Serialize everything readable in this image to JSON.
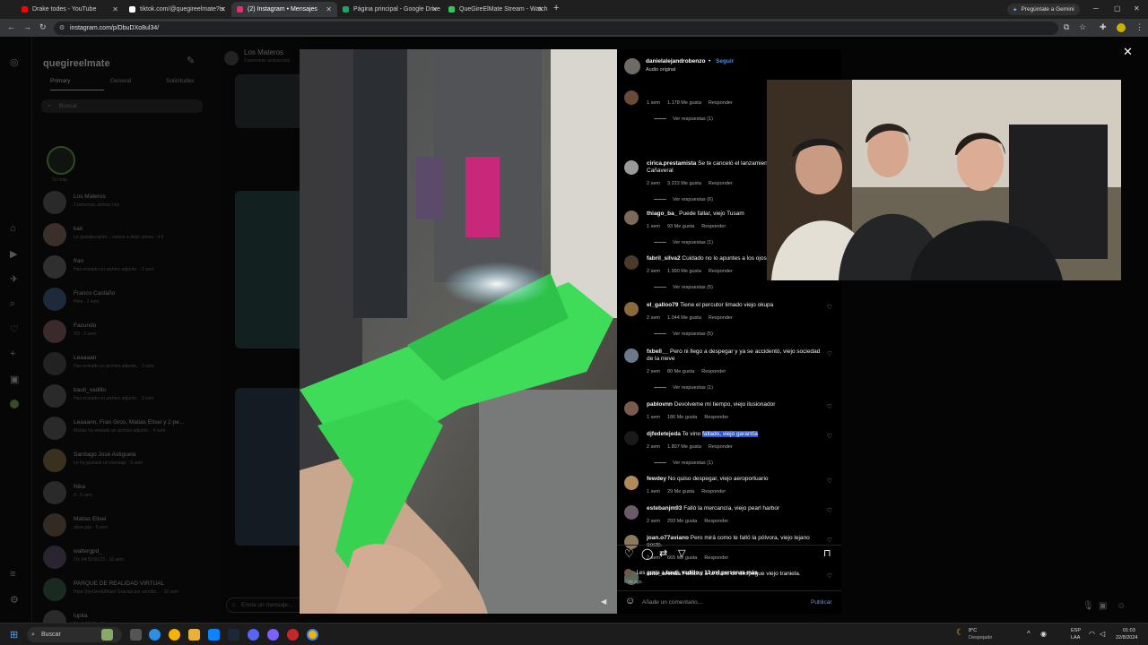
{
  "browser": {
    "tabs": [
      {
        "label": "Drake todes - YouTube",
        "active": false,
        "color": "#ff0000"
      },
      {
        "label": "tiktok.com/@quegireelmate?is",
        "active": false,
        "color": "#ffffff"
      },
      {
        "label": "(2) Instagram • Mensajes",
        "active": true,
        "color": "#e1306c"
      },
      {
        "label": "Página principal - Google Drive",
        "active": false,
        "color": "#1fa463"
      },
      {
        "label": "QueGireElMate Stream - Watch",
        "active": false,
        "color": "#34c759"
      }
    ],
    "gemini_label": "Pregúntale a Gemini",
    "url": "instagram.com/p/DbuDXo8ul34/"
  },
  "sidebar_icons": [
    "instagram-icon",
    "home-icon",
    "reels-icon",
    "messages-icon",
    "search-icon",
    "notifications-icon",
    "create-icon",
    "profile-icon",
    "menu-icon",
    "more-icon"
  ],
  "dm": {
    "username": "quegireelmate",
    "tabs": [
      "Primary",
      "General",
      "Solicitudes"
    ],
    "search_placeholder": "Buscar",
    "note_caption": "Tu nota",
    "conversations": [
      {
        "name": "Los Materos",
        "sub": "2 personas activas hoy"
      },
      {
        "name": "kari",
        "sub": "Le gustaba tanto... vamos a dejar juntas · 4 d"
      },
      {
        "name": "fran",
        "sub": "Has enviado un archivo adjunto. · 2 sem"
      },
      {
        "name": "Franco Castaño",
        "sub": "Hola · 2 sem"
      },
      {
        "name": "Facundo",
        "sub": "XD · 2 sem"
      },
      {
        "name": "Leaaaan",
        "sub": "Has enviado un archivo adjunto. · 3 sem"
      },
      {
        "name": "bauti_vadillo",
        "sub": "Has enviado un archivo adjunto. · 3 sem"
      },
      {
        "name": "Leaaann, Fran Gros, Matias Elisei y 2 pe...",
        "sub": "Matias ha enviado un archivo adjunto. · 4 sem"
      },
      {
        "name": "Santiago José Astiguela",
        "sub": "Le ha gustado un mensaje · 5 sem"
      },
      {
        "name": "Nika",
        "sub": "3 · 5 sem"
      },
      {
        "name": "Matias Elisei",
        "sub": "abue juju · 5 sem"
      },
      {
        "name": "waltergpd_",
        "sub": "Tú: 04:53:00:23 · 10 sem"
      },
      {
        "name": "PARQUE DE REALIDAD VIRTUAL",
        "sub": "Hola QueGireElMate! Gracias por escribir... · 10 sem"
      },
      {
        "name": "lupita",
        "sub": "Tú: 0:00:00 · 10 sem"
      }
    ]
  },
  "chat": {
    "title": "Los Materos",
    "subtitle": "2 personas activas hoy",
    "input_placeholder": "Envía un mensaje..."
  },
  "post": {
    "author": "danielalejandrobenzo",
    "follow": "Seguir",
    "audio": "Audio original",
    "comments": [
      {
        "user": "",
        "text": "",
        "time": "1 sem",
        "likes": "1.178 Me gusta",
        "reply": "Responder",
        "replies": "Ver respuestas (1)"
      },
      {
        "user": "cirica.prestamista",
        "text": "Se te canceló el lanzamiento, viejo Cabo Cañaveral",
        "time": "2 sem",
        "likes": "3.222 Me gusta",
        "reply": "Responder",
        "replies": "Ver respuestas (6)"
      },
      {
        "user": "thiago_ba_",
        "text": "Puede fallar, viejo Tusam",
        "time": "1 sem",
        "likes": "93 Me gusta",
        "reply": "Responder",
        "replies": "Ver respuestas (1)"
      },
      {
        "user": "fabril_silva2",
        "text": "Cuidado no lo apuntes a los ojos, viejo",
        "time": "2 sem",
        "likes": "1.990 Me gusta",
        "reply": "Responder",
        "replies": "Ver respuestas (5)"
      },
      {
        "user": "el_galloo79",
        "text": "Tiene el percutor limado viejo okupa",
        "time": "2 sem",
        "likes": "1.044 Me gusta",
        "reply": "Responder",
        "replies": "Ver respuestas (5)"
      },
      {
        "user": "fxbell__",
        "text": "Pero ni llego a despegar y ya se accidentó, viejo sociedad de la nieve",
        "time": "2 sem",
        "likes": "80 Me gusta",
        "reply": "Responder",
        "replies": "Ver respuestas (1)"
      },
      {
        "user": "pablovnn",
        "text": "Devolveme mi tiempo, viejo ilusionador",
        "time": "1 sem",
        "likes": "186 Me gusta",
        "reply": "Responder",
        "replies": ""
      },
      {
        "user": "djfedetejeda",
        "text_pre": "Te vino ",
        "text_hl": "fallado, viejo garantía",
        "time": "2 sem",
        "likes": "1.807 Me gusta",
        "reply": "Responder",
        "replies": "Ver respuestas (1)"
      },
      {
        "user": "fewdey",
        "text": "No quiso despegar, viejo aeroportuario",
        "time": "1 sem",
        "likes": "29 Me gusta",
        "reply": "Responder",
        "replies": ""
      },
      {
        "user": "estebanjm93",
        "text": "Falló la mercancía, viejo pearl harbor",
        "time": "2 sem",
        "likes": "293 Me gusta",
        "reply": "Responder",
        "replies": ""
      },
      {
        "user": "joan.o77aviano",
        "text": "Pero mirá como te falló la pólvora, viejo lejano oeste.",
        "time": "2 sem",
        "likes": "665 Me gusta",
        "reply": "Responder",
        "replies": ""
      },
      {
        "user": "alito_arenas",
        "text": "Faltaste a la clase de despegue viejo tranielа.",
        "time": "",
        "likes": "",
        "reply": "",
        "replies": ""
      }
    ],
    "likes_line_pre": "Les gusta a ",
    "likes_user": "bauti_vadillo",
    "likes_line_mid": " y ",
    "likes_count": "13 mil personas más",
    "date": "6 de ago.",
    "add_comment_placeholder": "Añade un comentario...",
    "publish": "Publicar"
  },
  "taskbar": {
    "search": "Buscar",
    "weather_temp": "8°C",
    "weather_desc": "Despejado",
    "lang_top": "ESP",
    "lang_bottom": "LAA",
    "time": "01:03",
    "date": "22/8/2024"
  },
  "colors": {
    "highlight": "#2b58d6",
    "follow_blue": "#4b8cf7",
    "toy_green": "#3fdc5a"
  }
}
